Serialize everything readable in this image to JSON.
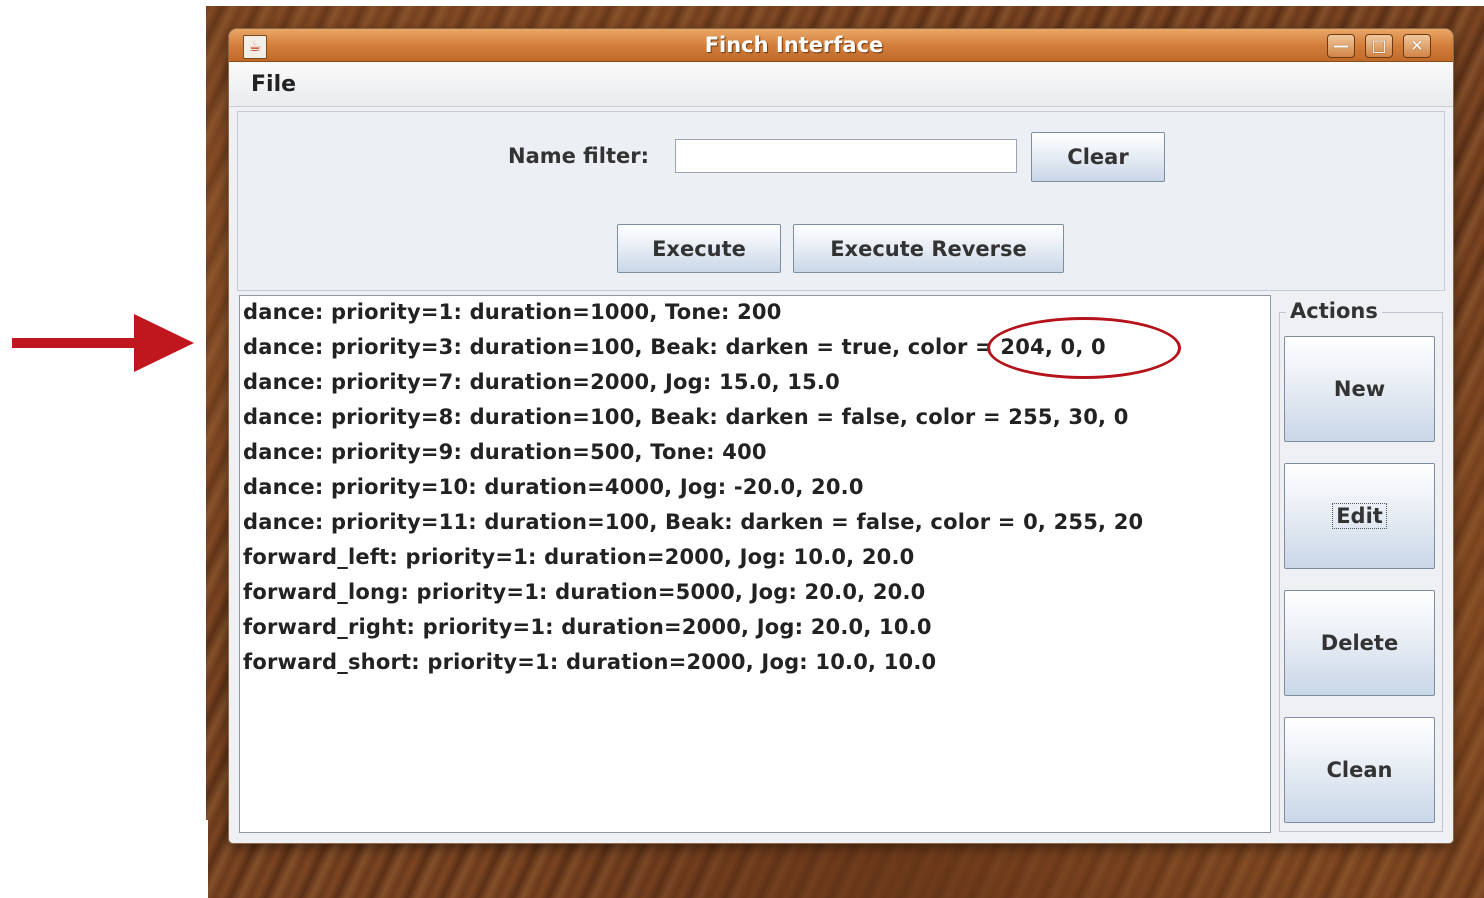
{
  "window": {
    "title": "Finch Interface",
    "icon": "java-icon",
    "controls": [
      "minimize-icon",
      "maximize-icon",
      "close-icon"
    ]
  },
  "menu": {
    "file_label": "File"
  },
  "filter": {
    "label": "Name filter:",
    "value": "",
    "clear_label": "Clear"
  },
  "execute": {
    "execute_label": "Execute",
    "execute_reverse_label": "Execute Reverse"
  },
  "list": {
    "items": [
      "dance: priority=1: duration=1000, Tone: 200",
      "dance: priority=3: duration=100, Beak: darken = true, color = 204, 0, 0",
      "dance: priority=7: duration=2000, Jog: 15.0, 15.0",
      "dance: priority=8: duration=100, Beak: darken = false, color = 255, 30, 0",
      "dance: priority=9: duration=500, Tone: 400",
      "dance: priority=10: duration=4000, Jog: -20.0, 20.0",
      "dance: priority=11: duration=100, Beak: darken = false, color = 0, 255, 20",
      "forward_left: priority=1: duration=2000, Jog: 10.0, 20.0",
      "forward_long: priority=1: duration=5000, Jog: 20.0, 20.0",
      "forward_right: priority=1: duration=2000, Jog: 20.0, 10.0",
      "forward_short: priority=1: duration=2000, Jog: 10.0, 10.0"
    ]
  },
  "actions": {
    "title": "Actions",
    "new_label": "New",
    "edit_label": "Edit",
    "delete_label": "Delete",
    "clean_label": "Clean"
  },
  "colors": {
    "titlebar": "#d37f3b",
    "annotation": "#b5121b"
  }
}
